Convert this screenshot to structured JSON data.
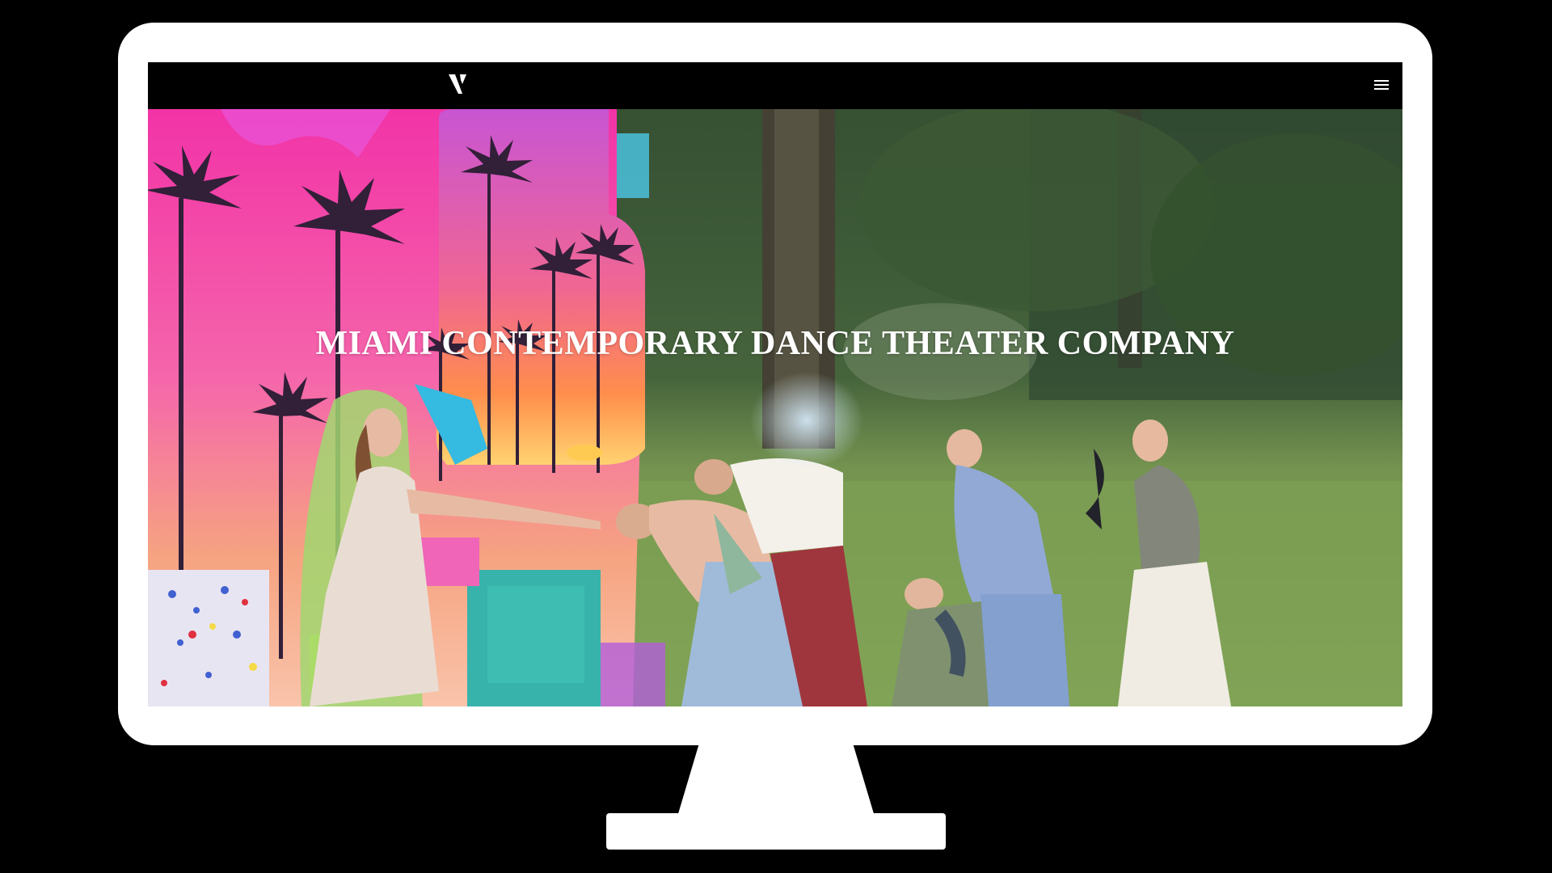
{
  "header": {
    "logo_icon": "v-monogram-logo",
    "menu_icon": "hamburger-menu-icon"
  },
  "hero": {
    "title": "MIAMI CONTEMPORARY DANCE THEATER COMPANY",
    "image_description_icon": "dancers-collage-photo"
  },
  "colors": {
    "background": "#000000",
    "bezel": "#ffffff",
    "title_text": "#ffffff",
    "collage_pink": "#f0449c",
    "collage_teal": "#2fb0a8",
    "grass_green": "#6a8f3c"
  }
}
